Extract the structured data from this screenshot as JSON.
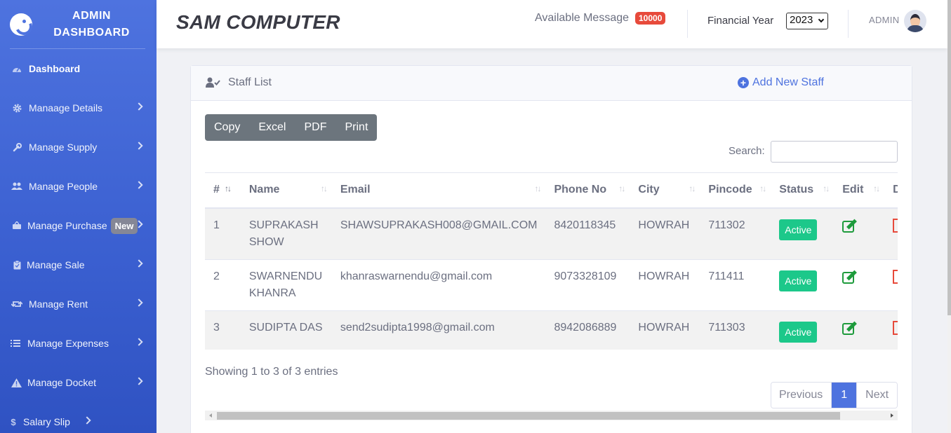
{
  "sidebar": {
    "brand_line1": "ADMIN",
    "brand_line2": "DASHBOARD",
    "items": [
      {
        "label": "Dashboard",
        "icon": "tachometer-icon"
      },
      {
        "label": "Manaage Details",
        "icon": "gear-icon"
      },
      {
        "label": "Manage Supply",
        "icon": "wrench-icon"
      },
      {
        "label": "Manage People",
        "icon": "users-icon"
      },
      {
        "label": "Manage Purchase",
        "icon": "basket-icon",
        "badge": "New"
      },
      {
        "label": "Manage Sale",
        "icon": "clipboard-icon"
      },
      {
        "label": "Manage Rent",
        "icon": "retweet-icon"
      },
      {
        "label": "Manage Expenses",
        "icon": "list-icon"
      },
      {
        "label": "Manage Docket",
        "icon": "warning-icon"
      },
      {
        "label": "Salary Slip",
        "icon": "dollar-icon"
      }
    ]
  },
  "topbar": {
    "company": "SAM COMPUTER",
    "available_message_label": "Available Message",
    "available_message_count": "10000",
    "financial_year_label": "Financial Year",
    "financial_year_value": "2023",
    "user_name": "ADMIN"
  },
  "card": {
    "title": "Staff List",
    "add_label": "Add New Staff",
    "buttons": [
      "Copy",
      "Excel",
      "PDF",
      "Print"
    ],
    "search_label": "Search:",
    "columns": [
      "#",
      "Name",
      "Email",
      "Phone No",
      "City",
      "Pincode",
      "Status",
      "Edit",
      "D"
    ],
    "rows": [
      {
        "num": "1",
        "name": "SUPRAKASH SHOW",
        "email": "SHAWSUPRAKASH008@GMAIL.COM",
        "phone": "8420118345",
        "city": "HOWRAH",
        "pincode": "711302",
        "status": "Active"
      },
      {
        "num": "2",
        "name": "SWARNENDU KHANRA",
        "email": "khanraswarnendu@gmail.com",
        "phone": "9073328109",
        "city": "HOWRAH",
        "pincode": "711411",
        "status": "Active"
      },
      {
        "num": "3",
        "name": "SUDIPTA DAS",
        "email": "send2sudipta1998@gmail.com",
        "phone": "8942086889",
        "city": "HOWRAH",
        "pincode": "711303",
        "status": "Active"
      }
    ],
    "info": "Showing 1 to 3 of 3 entries",
    "pager": {
      "previous": "Previous",
      "current": "1",
      "next": "Next"
    }
  },
  "colors": {
    "primary": "#4e73df",
    "success": "#1cc88a",
    "danger": "#e74a3b",
    "secondary": "#6c757d"
  }
}
